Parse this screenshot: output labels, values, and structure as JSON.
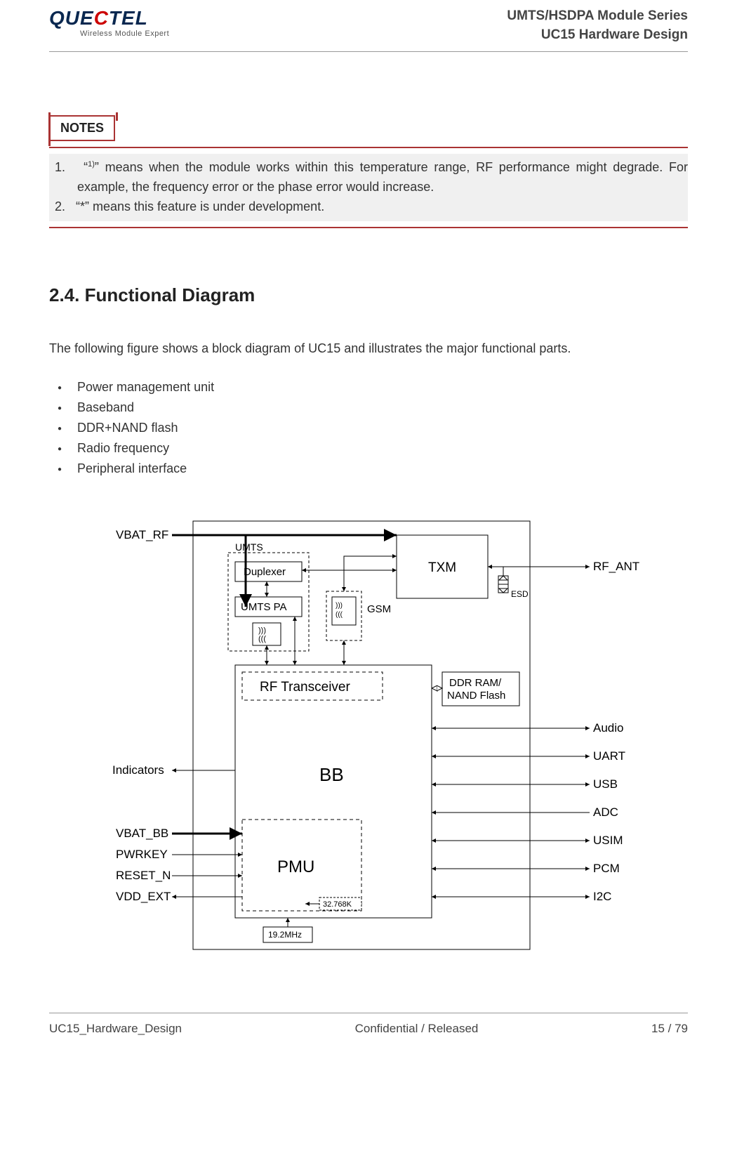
{
  "header": {
    "logo_main_part1": "QUE",
    "logo_main_part2": "C",
    "logo_main_part3": "TEL",
    "logo_sub": "Wireless Module Expert",
    "series": "UMTS/HSDPA Module Series",
    "product": "UC15 Hardware Design"
  },
  "notes": {
    "label": "NOTES",
    "items": [
      "“1)” means when the module works within this temperature range, RF performance might degrade. For example, the frequency error or the phase error would increase.",
      "“*” means this feature is under development."
    ]
  },
  "section": {
    "heading": "2.4. Functional Diagram",
    "intro": "The following figure shows a block diagram of UC15 and illustrates the major functional parts.",
    "bullets": [
      "Power management unit",
      "Baseband",
      "DDR+NAND flash",
      "Radio frequency",
      "Peripheral interface"
    ]
  },
  "diagram": {
    "left_inputs": [
      "VBAT_RF",
      "Indicators",
      "VBAT_BB",
      "PWRKEY",
      "RESET_N",
      "VDD_EXT"
    ],
    "right_io": [
      "RF_ANT",
      "Audio",
      "UART",
      "USB",
      "ADC",
      "USIM",
      "PCM",
      "I2C"
    ],
    "blocks": {
      "txm": "TXM",
      "umts": "UMTS",
      "duplexer": "Duplexer",
      "umts_pa": "UMTS PA",
      "gsm": "GSM",
      "rf_trx": "RF Transceiver",
      "ddr": "DDR RAM/",
      "ddr2": "NAND Flash",
      "bb": "BB",
      "pmu": "PMU",
      "osc1": "32.768K",
      "osc2": "19.2MHz",
      "esd": "ESD"
    }
  },
  "footer": {
    "left": "UC15_Hardware_Design",
    "center": "Confidential / Released",
    "right": "15 / 79"
  },
  "chart_data": {
    "type": "table",
    "title": "UC15 Functional Block Diagram — signal map",
    "nodes": [
      "VBAT_RF",
      "UMTS Duplexer",
      "UMTS PA",
      "TXM",
      "RF_ANT",
      "ESD",
      "GSM filter",
      "RF Transceiver",
      "BB",
      "DDR RAM/NAND Flash",
      "PMU",
      "19.2MHz",
      "32.768K",
      "Indicators",
      "VBAT_BB",
      "PWRKEY",
      "RESET_N",
      "VDD_EXT",
      "Audio",
      "UART",
      "USB",
      "ADC",
      "USIM",
      "PCM",
      "I2C"
    ],
    "edges": [
      {
        "from": "VBAT_RF",
        "to": "UMTS PA",
        "dir": "in"
      },
      {
        "from": "VBAT_RF",
        "to": "TXM",
        "dir": "in"
      },
      {
        "from": "UMTS PA",
        "to": "Duplexer",
        "dir": "bi"
      },
      {
        "from": "Duplexer",
        "to": "TXM",
        "dir": "bi"
      },
      {
        "from": "GSM filter",
        "to": "TXM",
        "dir": "bi"
      },
      {
        "from": "TXM",
        "to": "RF_ANT",
        "dir": "bi"
      },
      {
        "from": "RF_ANT",
        "to": "ESD",
        "dir": "shunt"
      },
      {
        "from": "RF Transceiver",
        "to": "UMTS PA",
        "dir": "bi"
      },
      {
        "from": "RF Transceiver",
        "to": "GSM filter",
        "dir": "bi"
      },
      {
        "from": "BB",
        "to": "RF Transceiver",
        "dir": "contains"
      },
      {
        "from": "BB",
        "to": "DDR RAM/NAND Flash",
        "dir": "bi"
      },
      {
        "from": "BB",
        "to": "Indicators",
        "dir": "out"
      },
      {
        "from": "BB",
        "to": "Audio",
        "dir": "bi"
      },
      {
        "from": "BB",
        "to": "UART",
        "dir": "bi"
      },
      {
        "from": "BB",
        "to": "USB",
        "dir": "bi"
      },
      {
        "from": "BB",
        "to": "ADC",
        "dir": "in"
      },
      {
        "from": "BB",
        "to": "USIM",
        "dir": "bi"
      },
      {
        "from": "BB",
        "to": "PCM",
        "dir": "bi"
      },
      {
        "from": "BB",
        "to": "I2C",
        "dir": "bi"
      },
      {
        "from": "PMU",
        "to": "BB",
        "dir": "contains"
      },
      {
        "from": "VBAT_BB",
        "to": "PMU",
        "dir": "in"
      },
      {
        "from": "PWRKEY",
        "to": "PMU",
        "dir": "in"
      },
      {
        "from": "RESET_N",
        "to": "PMU",
        "dir": "in"
      },
      {
        "from": "PMU",
        "to": "VDD_EXT",
        "dir": "out"
      },
      {
        "from": "19.2MHz",
        "to": "PMU",
        "dir": "in"
      },
      {
        "from": "32.768K",
        "to": "PMU",
        "dir": "in"
      }
    ]
  }
}
